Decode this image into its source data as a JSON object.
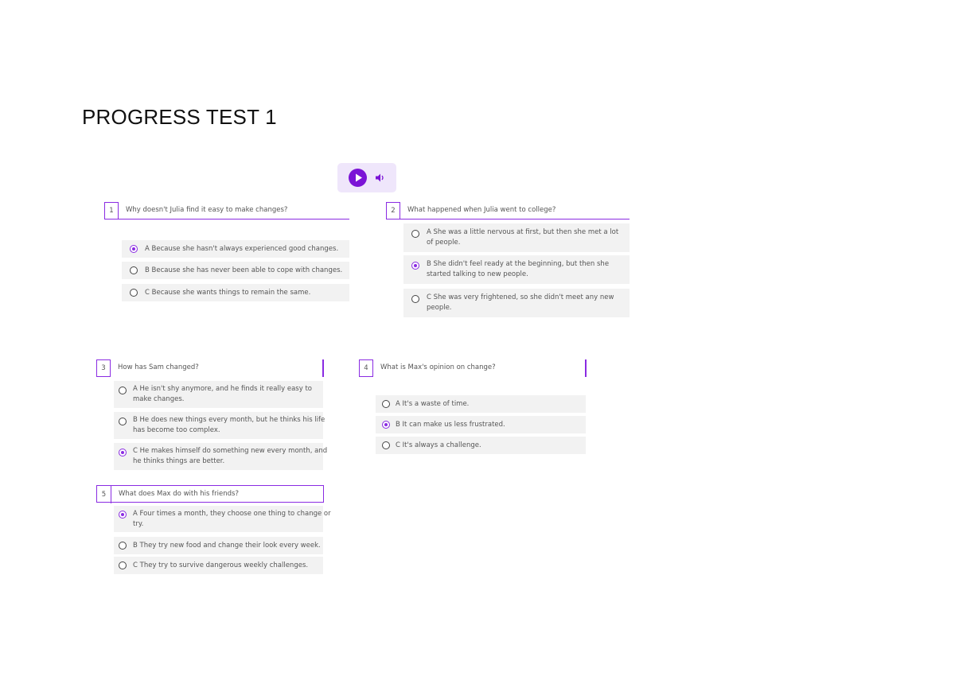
{
  "page": {
    "title": "PROGRESS TEST 1"
  },
  "audio": {
    "play_icon": "play-icon",
    "volume_icon": "volume-icon",
    "accent": "#7b14d6"
  },
  "questions": [
    {
      "number": "1",
      "text": "Why doesn't Julia find it easy to make changes?",
      "options": [
        {
          "text": "A Because she hasn't always experienced good changes.",
          "selected": true
        },
        {
          "text": "B Because she has never been able to cope with changes.",
          "selected": false
        },
        {
          "text": "C Because she wants things to remain the same.",
          "selected": false
        }
      ]
    },
    {
      "number": "2",
      "text": "What happened when Julia went to college?",
      "options": [
        {
          "line1": "A She was a little nervous at first, but then she met a lot",
          "line2": "of people.",
          "selected": false
        },
        {
          "line1": "B She didn't feel ready at the beginning, but then she",
          "line2": "started talking to new people.",
          "selected": true
        },
        {
          "line1": "C She was very frightened, so she didn't meet any new",
          "line2": "people.",
          "selected": false
        }
      ]
    },
    {
      "number": "3",
      "text": "How has Sam changed?",
      "options": [
        {
          "line1": "A He isn't shy anymore, and he finds it really easy to",
          "line2": "make changes.",
          "selected": false
        },
        {
          "line1": "B He does new things every month, but he thinks his life",
          "line2": "has become too complex.",
          "selected": false
        },
        {
          "line1": "C He makes himself do something new every month, and",
          "line2": "he thinks things are better.",
          "selected": true
        }
      ]
    },
    {
      "number": "4",
      "text": "What is Max's opinion on change?",
      "options": [
        {
          "text": "A It's a waste of time.",
          "selected": false
        },
        {
          "text": "B It can make us less frustrated.",
          "selected": true
        },
        {
          "text": "C It's always a challenge.",
          "selected": false
        }
      ]
    },
    {
      "number": "5",
      "text": "What does Max do with his friends?",
      "options": [
        {
          "line1": "A Four times a month, they choose one thing to change or",
          "line2": "try.",
          "selected": true
        },
        {
          "text": "B They try new food and change their look every week.",
          "selected": false
        },
        {
          "text": "C They try to survive dangerous weekly challenges.",
          "selected": false
        }
      ]
    }
  ]
}
